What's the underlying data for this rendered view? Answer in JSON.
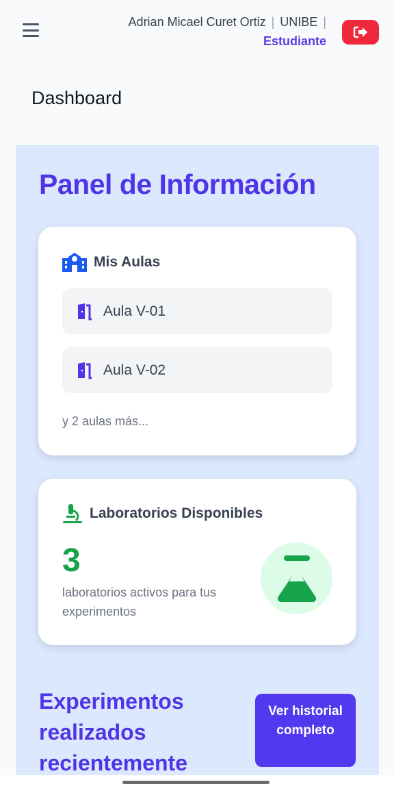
{
  "header": {
    "user_name": "Adrian Micael Curet Ortiz",
    "institution": "UNIBE",
    "separator": "|",
    "role": "Estudiante"
  },
  "breadcrumb": "Dashboard",
  "panel": {
    "title": "Panel de Información",
    "aulas_card": {
      "title": "Mis Aulas",
      "items": [
        {
          "label": "Aula V-01"
        },
        {
          "label": "Aula V-02"
        }
      ],
      "more": "y 2 aulas más..."
    },
    "labs_card": {
      "title": "Laboratorios Disponibles",
      "count": "3",
      "description": "laboratorios activos para tus experimentos"
    },
    "experiments": {
      "title": "Experimentos realizados recientemente",
      "button": "Ver historial completo"
    }
  },
  "colors": {
    "accent": "#4f35e6",
    "danger": "#f0283c",
    "success": "#16a34a",
    "panel_bg": "#dbe8fd"
  }
}
